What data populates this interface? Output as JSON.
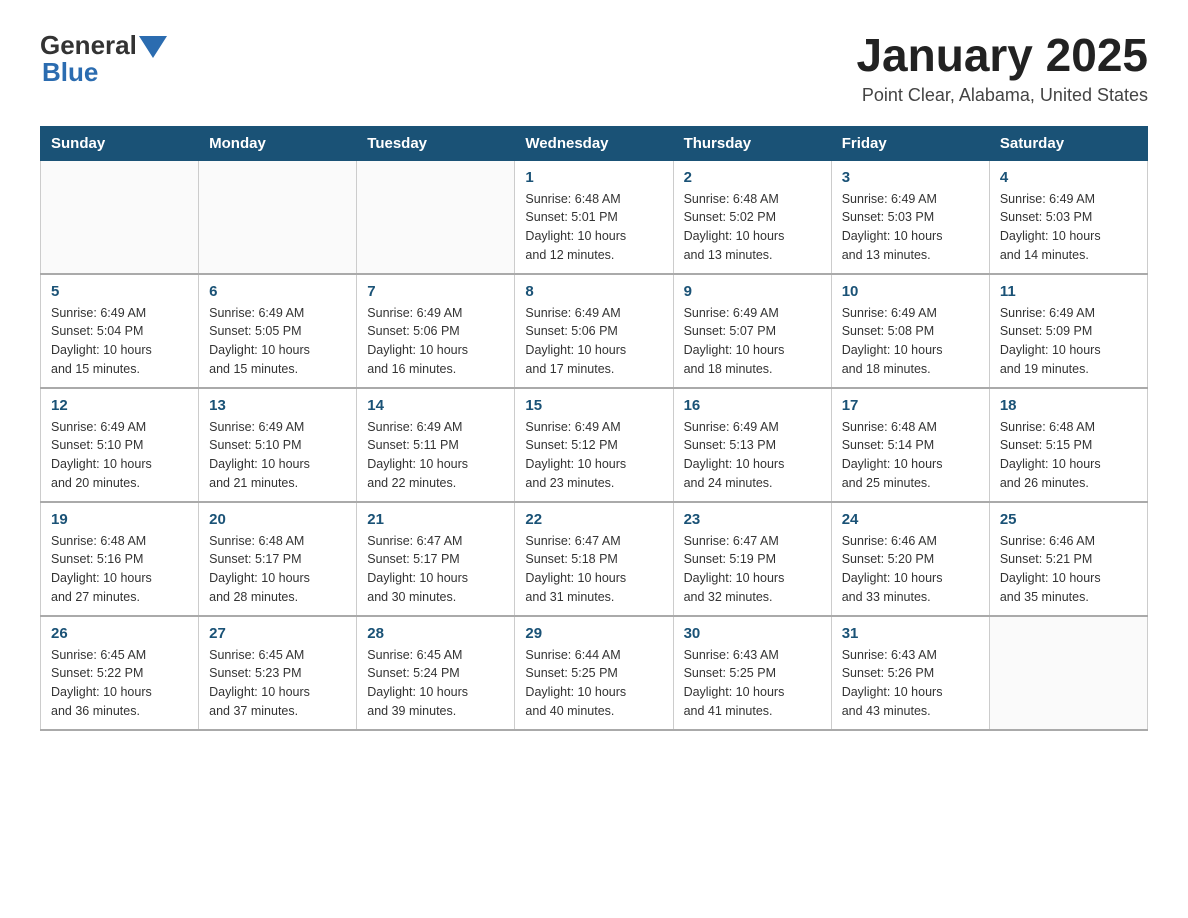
{
  "header": {
    "logo_general": "General",
    "logo_blue": "Blue",
    "month_title": "January 2025",
    "location": "Point Clear, Alabama, United States"
  },
  "days_of_week": [
    "Sunday",
    "Monday",
    "Tuesday",
    "Wednesday",
    "Thursday",
    "Friday",
    "Saturday"
  ],
  "weeks": [
    [
      {
        "day": "",
        "info": ""
      },
      {
        "day": "",
        "info": ""
      },
      {
        "day": "",
        "info": ""
      },
      {
        "day": "1",
        "info": "Sunrise: 6:48 AM\nSunset: 5:01 PM\nDaylight: 10 hours\nand 12 minutes."
      },
      {
        "day": "2",
        "info": "Sunrise: 6:48 AM\nSunset: 5:02 PM\nDaylight: 10 hours\nand 13 minutes."
      },
      {
        "day": "3",
        "info": "Sunrise: 6:49 AM\nSunset: 5:03 PM\nDaylight: 10 hours\nand 13 minutes."
      },
      {
        "day": "4",
        "info": "Sunrise: 6:49 AM\nSunset: 5:03 PM\nDaylight: 10 hours\nand 14 minutes."
      }
    ],
    [
      {
        "day": "5",
        "info": "Sunrise: 6:49 AM\nSunset: 5:04 PM\nDaylight: 10 hours\nand 15 minutes."
      },
      {
        "day": "6",
        "info": "Sunrise: 6:49 AM\nSunset: 5:05 PM\nDaylight: 10 hours\nand 15 minutes."
      },
      {
        "day": "7",
        "info": "Sunrise: 6:49 AM\nSunset: 5:06 PM\nDaylight: 10 hours\nand 16 minutes."
      },
      {
        "day": "8",
        "info": "Sunrise: 6:49 AM\nSunset: 5:06 PM\nDaylight: 10 hours\nand 17 minutes."
      },
      {
        "day": "9",
        "info": "Sunrise: 6:49 AM\nSunset: 5:07 PM\nDaylight: 10 hours\nand 18 minutes."
      },
      {
        "day": "10",
        "info": "Sunrise: 6:49 AM\nSunset: 5:08 PM\nDaylight: 10 hours\nand 18 minutes."
      },
      {
        "day": "11",
        "info": "Sunrise: 6:49 AM\nSunset: 5:09 PM\nDaylight: 10 hours\nand 19 minutes."
      }
    ],
    [
      {
        "day": "12",
        "info": "Sunrise: 6:49 AM\nSunset: 5:10 PM\nDaylight: 10 hours\nand 20 minutes."
      },
      {
        "day": "13",
        "info": "Sunrise: 6:49 AM\nSunset: 5:10 PM\nDaylight: 10 hours\nand 21 minutes."
      },
      {
        "day": "14",
        "info": "Sunrise: 6:49 AM\nSunset: 5:11 PM\nDaylight: 10 hours\nand 22 minutes."
      },
      {
        "day": "15",
        "info": "Sunrise: 6:49 AM\nSunset: 5:12 PM\nDaylight: 10 hours\nand 23 minutes."
      },
      {
        "day": "16",
        "info": "Sunrise: 6:49 AM\nSunset: 5:13 PM\nDaylight: 10 hours\nand 24 minutes."
      },
      {
        "day": "17",
        "info": "Sunrise: 6:48 AM\nSunset: 5:14 PM\nDaylight: 10 hours\nand 25 minutes."
      },
      {
        "day": "18",
        "info": "Sunrise: 6:48 AM\nSunset: 5:15 PM\nDaylight: 10 hours\nand 26 minutes."
      }
    ],
    [
      {
        "day": "19",
        "info": "Sunrise: 6:48 AM\nSunset: 5:16 PM\nDaylight: 10 hours\nand 27 minutes."
      },
      {
        "day": "20",
        "info": "Sunrise: 6:48 AM\nSunset: 5:17 PM\nDaylight: 10 hours\nand 28 minutes."
      },
      {
        "day": "21",
        "info": "Sunrise: 6:47 AM\nSunset: 5:17 PM\nDaylight: 10 hours\nand 30 minutes."
      },
      {
        "day": "22",
        "info": "Sunrise: 6:47 AM\nSunset: 5:18 PM\nDaylight: 10 hours\nand 31 minutes."
      },
      {
        "day": "23",
        "info": "Sunrise: 6:47 AM\nSunset: 5:19 PM\nDaylight: 10 hours\nand 32 minutes."
      },
      {
        "day": "24",
        "info": "Sunrise: 6:46 AM\nSunset: 5:20 PM\nDaylight: 10 hours\nand 33 minutes."
      },
      {
        "day": "25",
        "info": "Sunrise: 6:46 AM\nSunset: 5:21 PM\nDaylight: 10 hours\nand 35 minutes."
      }
    ],
    [
      {
        "day": "26",
        "info": "Sunrise: 6:45 AM\nSunset: 5:22 PM\nDaylight: 10 hours\nand 36 minutes."
      },
      {
        "day": "27",
        "info": "Sunrise: 6:45 AM\nSunset: 5:23 PM\nDaylight: 10 hours\nand 37 minutes."
      },
      {
        "day": "28",
        "info": "Sunrise: 6:45 AM\nSunset: 5:24 PM\nDaylight: 10 hours\nand 39 minutes."
      },
      {
        "day": "29",
        "info": "Sunrise: 6:44 AM\nSunset: 5:25 PM\nDaylight: 10 hours\nand 40 minutes."
      },
      {
        "day": "30",
        "info": "Sunrise: 6:43 AM\nSunset: 5:25 PM\nDaylight: 10 hours\nand 41 minutes."
      },
      {
        "day": "31",
        "info": "Sunrise: 6:43 AM\nSunset: 5:26 PM\nDaylight: 10 hours\nand 43 minutes."
      },
      {
        "day": "",
        "info": ""
      }
    ]
  ]
}
